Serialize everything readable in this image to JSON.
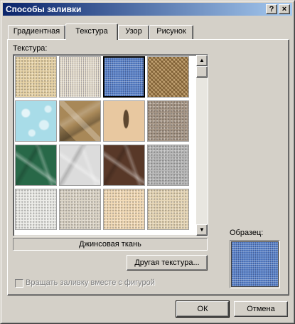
{
  "window": {
    "title": "Способы заливки",
    "help_glyph": "?",
    "close_glyph": "×"
  },
  "tabs": [
    {
      "label": "Градиентная",
      "active": false
    },
    {
      "label": "Текстура",
      "active": true
    },
    {
      "label": "Узор",
      "active": false
    },
    {
      "label": "Рисунок",
      "active": false
    }
  ],
  "texture_label": "Текстура:",
  "textures": [
    {
      "name": "papyrus",
      "color": "#e8d4a8",
      "selected": false
    },
    {
      "name": "canvas",
      "color": "#e4dccb",
      "selected": false
    },
    {
      "name": "denim",
      "color": "#5a82c8",
      "selected": true
    },
    {
      "name": "woven-mat",
      "color": "#c8a878",
      "selected": false
    },
    {
      "name": "water-droplets",
      "color": "#a8dce8",
      "selected": false
    },
    {
      "name": "paper-bag",
      "color": "#a88858",
      "selected": false
    },
    {
      "name": "fish-fossil",
      "color": "#e8c8a0",
      "selected": false
    },
    {
      "name": "sand",
      "color": "#a89888",
      "selected": false
    },
    {
      "name": "green-marble",
      "color": "#286848",
      "selected": false
    },
    {
      "name": "white-marble",
      "color": "#dcdcdc",
      "selected": false
    },
    {
      "name": "brown-marble",
      "color": "#583828",
      "selected": false
    },
    {
      "name": "granite",
      "color": "#b8b8b8",
      "selected": false
    },
    {
      "name": "recycled-paper",
      "color": "#ecece8",
      "selected": false
    },
    {
      "name": "newsprint",
      "color": "#ddd6c8",
      "selected": false
    },
    {
      "name": "parchment",
      "color": "#f4dcb8",
      "selected": false
    },
    {
      "name": "stationery",
      "color": "#e8d8b8",
      "selected": false
    }
  ],
  "selected_texture_name": "Джинсовая ткань",
  "other_texture_button": "Другая текстура...",
  "rotate_checkbox": {
    "label": "Вращать заливку вместе с фигурой",
    "checked": false,
    "enabled": false
  },
  "sample_label": "Образец:",
  "sample_color": "#5a82c8",
  "buttons": {
    "ok": "ОК",
    "cancel": "Отмена"
  },
  "icons": {
    "scroll_up": "▲",
    "scroll_down": "▼"
  }
}
